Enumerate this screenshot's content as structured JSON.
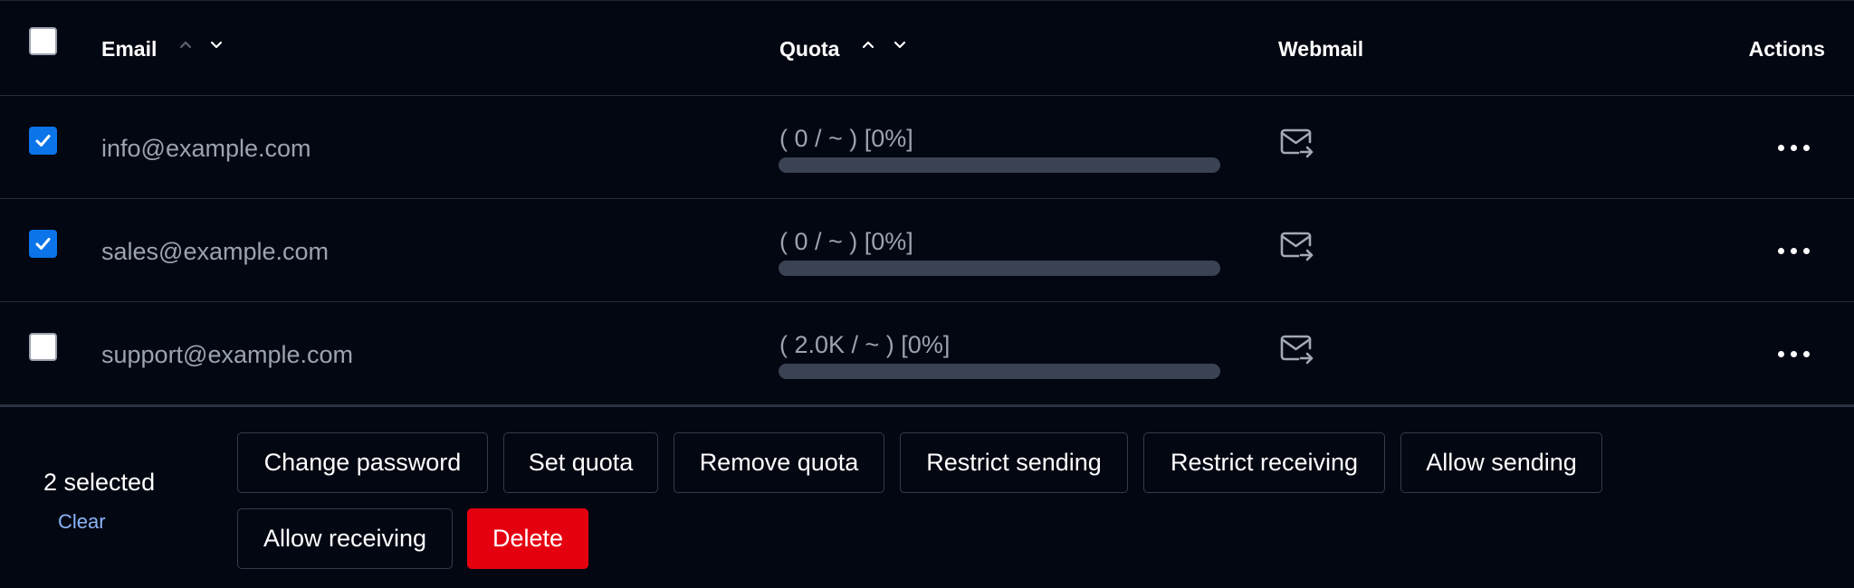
{
  "table": {
    "headers": {
      "email": "Email",
      "quota": "Quota",
      "webmail": "Webmail",
      "actions": "Actions"
    },
    "select_all_checked": false,
    "rows": [
      {
        "email": "info@example.com",
        "quota_text": "( 0 / ~ ) [0%]",
        "quota_percent": 0,
        "checked": true
      },
      {
        "email": "sales@example.com",
        "quota_text": "( 0 / ~ ) [0%]",
        "quota_percent": 0,
        "checked": true
      },
      {
        "email": "support@example.com",
        "quota_text": "( 2.0K / ~ ) [0%]",
        "quota_percent": 0,
        "checked": false
      }
    ]
  },
  "icons": {
    "sort_up": "chevron-up-icon",
    "sort_down": "chevron-down-icon",
    "webmail": "mail-forward-icon",
    "actions": "more-horizontal-icon",
    "check": "checkmark-icon"
  },
  "bulk_actions": {
    "selected_label": "2 selected",
    "clear_label": "Clear",
    "buttons": {
      "change_password": "Change password",
      "set_quota": "Set quota",
      "remove_quota": "Remove quota",
      "restrict_sending": "Restrict sending",
      "restrict_receiving": "Restrict receiving",
      "allow_sending": "Allow sending",
      "allow_receiving": "Allow receiving",
      "delete": "Delete"
    }
  },
  "colors": {
    "background": "#030712",
    "checkbox_checked": "#0b74e8",
    "danger": "#e5000f",
    "link": "#8ab4f8",
    "muted_text": "#9ca3af",
    "progress_track": "#3a4254"
  }
}
